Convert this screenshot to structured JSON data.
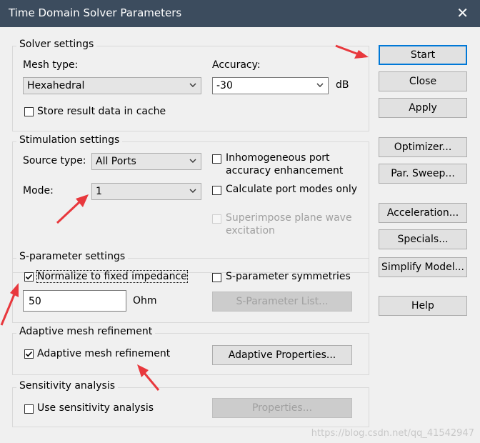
{
  "window": {
    "title": "Time Domain Solver Parameters",
    "close_glyph": "✕"
  },
  "solver_settings": {
    "group_label": "Solver settings",
    "mesh_type_label": "Mesh type:",
    "mesh_type_value": "Hexahedral",
    "accuracy_label": "Accuracy:",
    "accuracy_value": "-30",
    "accuracy_unit": "dB",
    "store_cache_label": "Store result data in cache",
    "store_cache_checked": false
  },
  "stimulation_settings": {
    "group_label": "Stimulation settings",
    "source_type_label": "Source type:",
    "source_type_value": "All Ports",
    "mode_label": "Mode:",
    "mode_value": "1",
    "inhomogeneous_label_line1": "Inhomogeneous port",
    "inhomogeneous_label_line2": "accuracy enhancement",
    "calc_port_modes_label": "Calculate port modes only",
    "superimpose_label_line1": "Superimpose plane wave",
    "superimpose_label_line2": "excitation"
  },
  "s_parameter_settings": {
    "group_label": "S-parameter settings",
    "normalize_label": "Normalize to fixed impedance",
    "normalize_checked": true,
    "impedance_value": "50",
    "impedance_unit": "Ohm",
    "symmetries_label": "S-parameter symmetries",
    "s_parameter_list_label": "S-Parameter List..."
  },
  "adaptive_mesh": {
    "group_label": "Adaptive mesh refinement",
    "checkbox_label": "Adaptive mesh refinement",
    "checkbox_checked": true,
    "properties_label": "Adaptive Properties..."
  },
  "sensitivity": {
    "group_label": "Sensitivity analysis",
    "checkbox_label": "Use sensitivity analysis",
    "properties_label": "Properties..."
  },
  "side_buttons": {
    "start": "Start",
    "close": "Close",
    "apply": "Apply",
    "optimizer": "Optimizer...",
    "par_sweep": "Par. Sweep...",
    "acceleration": "Acceleration...",
    "specials": "Specials...",
    "simplify_model": "Simplify Model...",
    "help": "Help"
  },
  "watermark": "https://blog.csdn.net/qq_41542947",
  "colors": {
    "titlebar": "#3c4c5e",
    "annotation_arrow": "#e8383d",
    "default_button_border": "#0078d7"
  }
}
